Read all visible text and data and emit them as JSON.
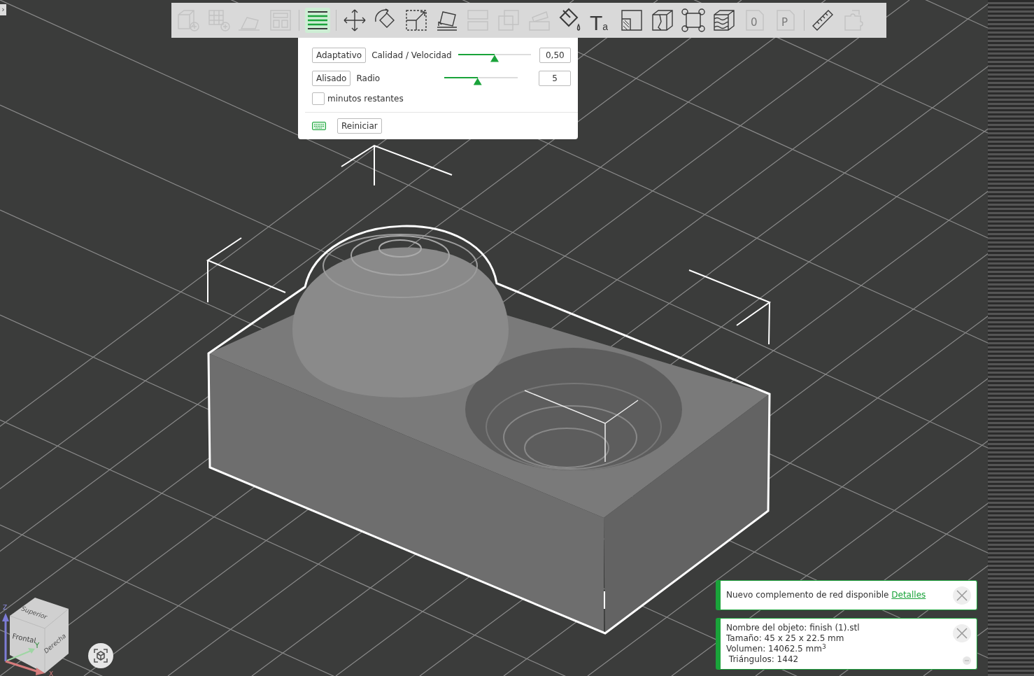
{
  "toolbar": {
    "tools": [
      {
        "kind": "cube-plus",
        "disabled": true,
        "selected": false
      },
      {
        "kind": "grid-plus",
        "disabled": true,
        "selected": false
      },
      {
        "kind": "auto-arrange",
        "disabled": true,
        "selected": false
      },
      {
        "kind": "layout",
        "disabled": true,
        "selected": false
      },
      {
        "kind": "layers",
        "disabled": false,
        "selected": true
      },
      {
        "kind": "move",
        "disabled": false,
        "selected": false
      },
      {
        "kind": "rotate",
        "disabled": false,
        "selected": false
      },
      {
        "kind": "scale",
        "disabled": false,
        "selected": false
      },
      {
        "kind": "lay-flat",
        "disabled": false,
        "selected": false
      },
      {
        "kind": "split",
        "disabled": true,
        "selected": false
      },
      {
        "kind": "overlap",
        "disabled": true,
        "selected": false
      },
      {
        "kind": "emboss",
        "disabled": true,
        "selected": false
      },
      {
        "kind": "paint",
        "disabled": false,
        "selected": false
      },
      {
        "kind": "text",
        "label": "Ta",
        "disabled": false,
        "selected": false
      },
      {
        "kind": "cut",
        "disabled": false,
        "selected": false
      },
      {
        "kind": "seam",
        "disabled": false,
        "selected": false
      },
      {
        "kind": "frame",
        "disabled": false,
        "selected": false
      },
      {
        "kind": "texture",
        "disabled": false,
        "selected": false
      },
      {
        "kind": "doc",
        "label": "0",
        "disabled": true,
        "selected": false
      },
      {
        "kind": "doc",
        "label": "P",
        "disabled": true,
        "selected": false
      },
      {
        "kind": "ruler",
        "disabled": false,
        "selected": false
      },
      {
        "kind": "puzzle",
        "disabled": true,
        "selected": false
      }
    ]
  },
  "layer_panel": {
    "rows": [
      {
        "button": "Adaptativo",
        "label": "Calidad / Velocidad",
        "level": 0.5,
        "value": "0,50"
      },
      {
        "button": "Alisado",
        "label": "Radio",
        "level": 0.45,
        "value": "5"
      }
    ],
    "checkbox": {
      "label": "minutos restantes",
      "checked": false
    },
    "reset_button": "Reiniciar"
  },
  "notifications": [
    {
      "kind": "link",
      "text": "Nuevo complemento de red disponible",
      "link": "Detalles"
    },
    {
      "kind": "info",
      "lines": [
        "Nombre del objeto: finish (1).stl",
        "Tamaño: 45 x 25 x 22.5 mm",
        "Volumen: 14062.5 mm$^{3}$",
        " Triángulos: 1442"
      ]
    }
  ],
  "view_cube": {
    "faces": [
      "Superior",
      "Frontal",
      "Derecha"
    ],
    "axes": [
      "Z",
      "Y",
      "X"
    ]
  },
  "side_toggle": "›"
}
